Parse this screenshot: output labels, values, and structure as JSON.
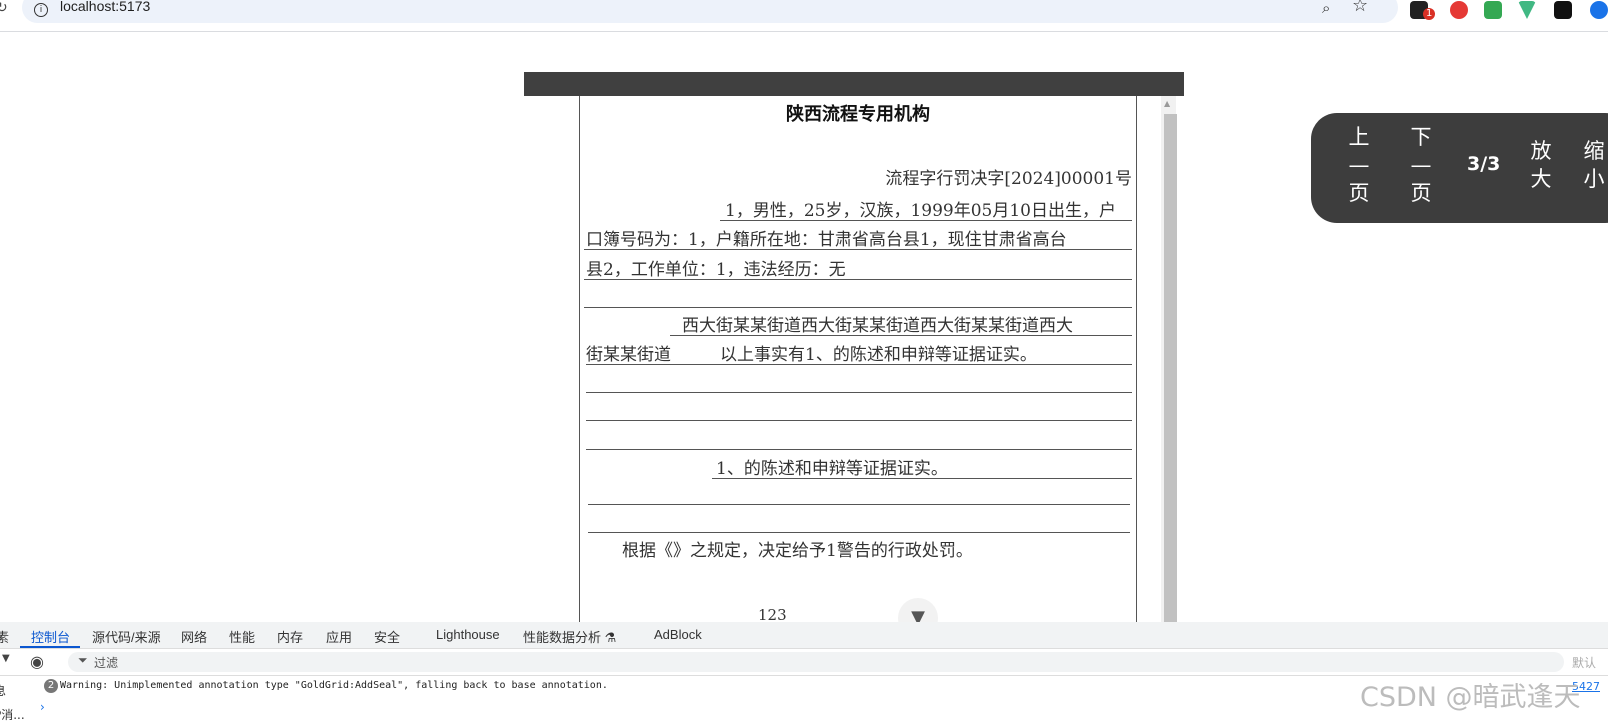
{
  "browser": {
    "url": "localhost:5173",
    "extension_badge": "1",
    "accent": "#0b57d0"
  },
  "document": {
    "title": "陕西流程专用机构",
    "number": "流程字行罚决字[2024]00001号",
    "lines": [
      "1，男性，25岁，汉族，1999年05月10日出生，户",
      "口簿号码为：1，户籍所在地：甘肃省高台县1，现住甘肃省高台",
      "县2，工作单位：1，违法经历：无",
      "西大街某某街道西大街某某街道西大街某某街道西大",
      "街某某街道",
      "以上事实有1、的陈述和申辩等证据证实。",
      "1、的陈述和申辩等证据证实。",
      "根据《》之规定，决定给予1警告的行政处罚。"
    ],
    "page_number": "123"
  },
  "pager": {
    "prev": "上一页",
    "next": "下一页",
    "info": "3/3",
    "zoom_in": "放大",
    "zoom_out": "缩小"
  },
  "devtools": {
    "tabs": [
      "素",
      "控制台",
      "源代码/来源",
      "网络",
      "性能",
      "内存",
      "应用",
      "安全",
      "Lighthouse",
      "性能数据分析 ⚗",
      "AdBlock"
    ],
    "filter_placeholder": "过滤",
    "default_levels": "默认",
    "warning_count": "2",
    "warning_text": "Warning: Unimplemented annotation type \"GoldGrid:AddSeal\", falling back to base annotation.",
    "warning_source": "5427",
    "side_labels": [
      "息",
      "P消..."
    ]
  },
  "watermark": "CSDN @暗武逢天"
}
